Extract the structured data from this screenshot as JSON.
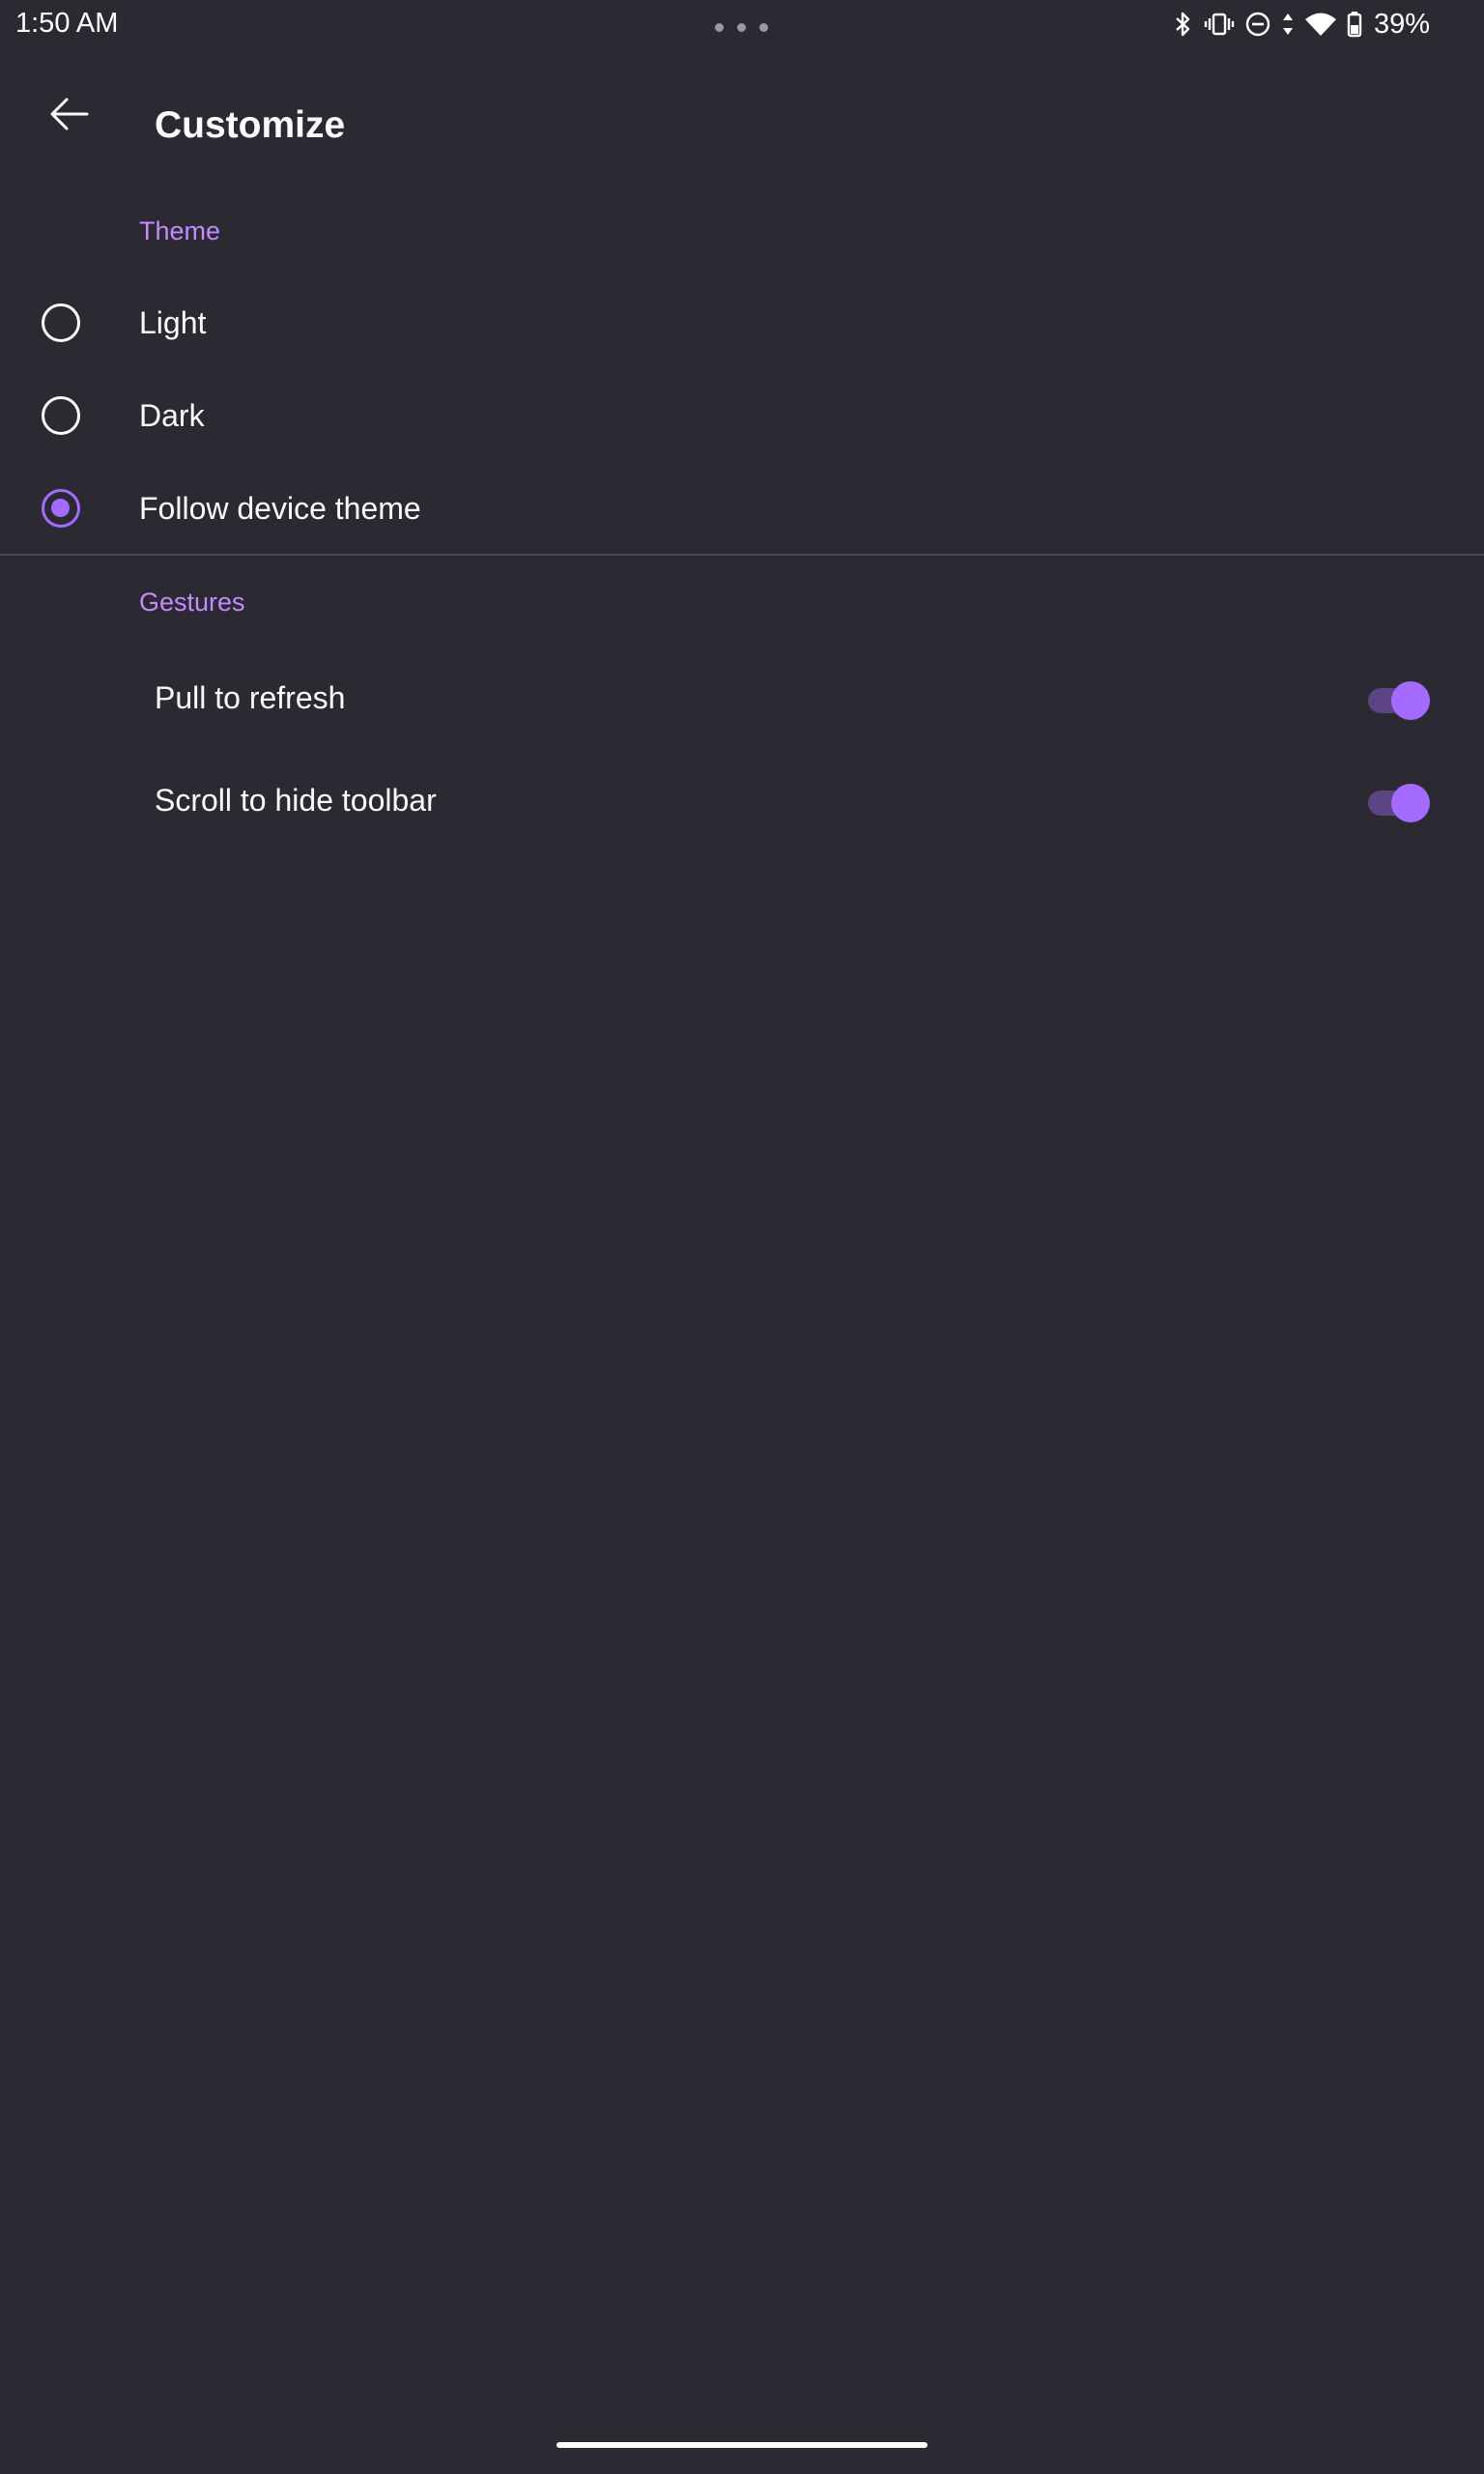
{
  "status_bar": {
    "time": "1:50 AM",
    "battery": "39%",
    "icons": [
      "bluetooth-icon",
      "vibrate-icon",
      "do-not-disturb-icon",
      "data-arrows-icon",
      "wifi-icon",
      "battery-icon"
    ]
  },
  "toolbar": {
    "title": "Customize",
    "back_icon": "arrow-back-icon"
  },
  "theme_section": {
    "header": "Theme",
    "options": [
      {
        "label": "Light",
        "checked": false
      },
      {
        "label": "Dark",
        "checked": false
      },
      {
        "label": "Follow device theme",
        "checked": true
      }
    ]
  },
  "gestures_section": {
    "header": "Gestures",
    "items": [
      {
        "label": "Pull to refresh",
        "enabled": true
      },
      {
        "label": "Scroll to hide toolbar",
        "enabled": true
      }
    ]
  },
  "colors": {
    "background": "#2b2a33",
    "accent": "#a56bff",
    "section_header": "#c689ff",
    "text": "#fbfbfe"
  }
}
